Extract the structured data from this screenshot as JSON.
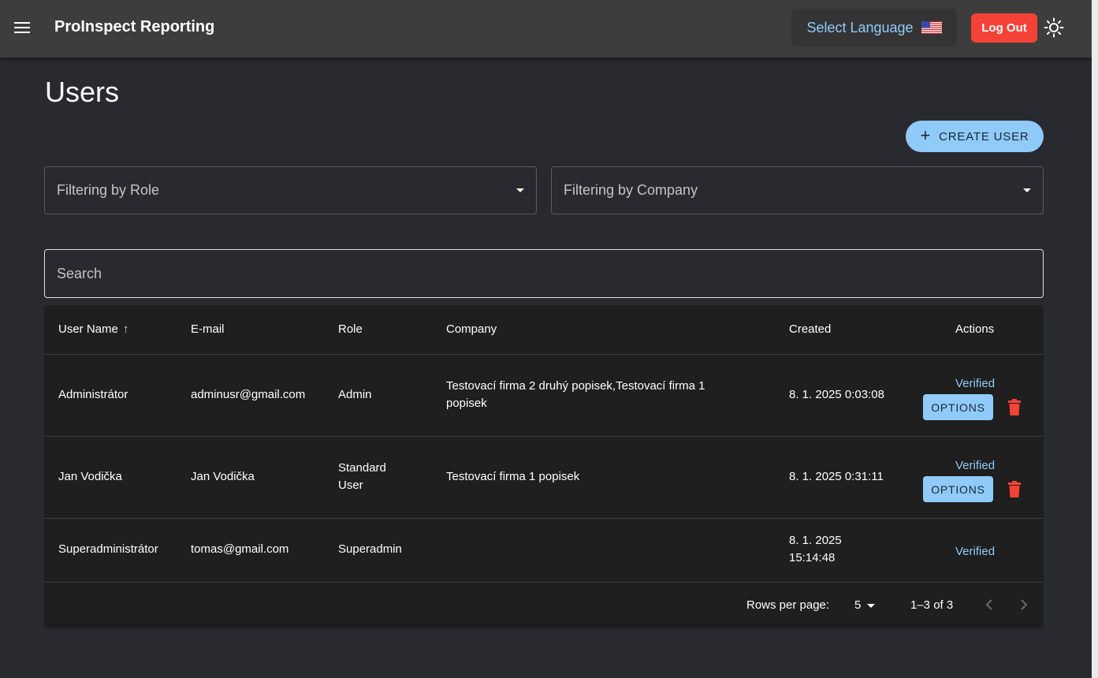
{
  "header": {
    "app_title": "ProInspect Reporting",
    "language_label": "Select Language",
    "logout_label": "Log Out",
    "menu_icon": "hamburger-menu-icon",
    "theme_icon": "sun-icon"
  },
  "page": {
    "title": "Users",
    "create_user_label": "CREATE USER"
  },
  "filters": {
    "role_placeholder": "Filtering by Role",
    "company_placeholder": "Filtering by Company"
  },
  "search": {
    "placeholder": "Search"
  },
  "table": {
    "columns": {
      "user_name": "User Name",
      "email": "E-mail",
      "role": "Role",
      "company": "Company",
      "created": "Created",
      "actions": "Actions"
    },
    "rows": [
      {
        "user_name": "Administrátor",
        "email": "adminusr@gmail.com",
        "role": "Admin",
        "company": "Testovací firma 2 druhý popisek,Testovací firma 1 popisek",
        "created": "8. 1. 2025 0:03:08",
        "status": "Verified",
        "options_label": "OPTIONS"
      },
      {
        "user_name": "Jan Vodička",
        "email": "Jan Vodička",
        "role": "Standard User",
        "company": "Testovací firma 1 popisek",
        "created": "8. 1. 2025 0:31:11",
        "status": "Verified",
        "options_label": "OPTIONS"
      },
      {
        "user_name": "Superadministrátor",
        "email": "tomas@gmail.com",
        "role": "Superadmin",
        "company": "",
        "created": "8. 1. 2025 15:14:48",
        "status": "Verified"
      }
    ]
  },
  "pagination": {
    "rows_per_page_label": "Rows per page:",
    "rows_per_page_value": "5",
    "range": "1–3 of 3"
  },
  "colors": {
    "accent": "#90caf9",
    "danger": "#f44336",
    "background": "#292a2f",
    "appbar": "#3d3d3d",
    "table_bg": "#1f1f1f"
  }
}
